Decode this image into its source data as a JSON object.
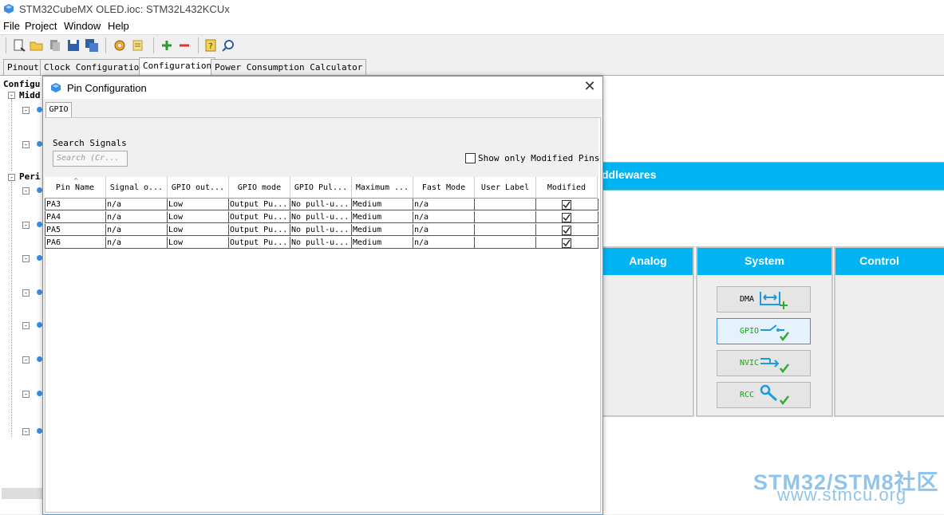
{
  "window": {
    "title": "STM32CubeMX OLED.ioc: STM32L432KCUx"
  },
  "menu": [
    "File",
    "Project",
    "Window",
    "Help"
  ],
  "tabs": [
    "Pinout",
    "Clock Configuration",
    "Configuration",
    "Power Consumption Calculator"
  ],
  "active_tab": "Configuration",
  "tree": {
    "root": "Configu",
    "middle": "Midd",
    "peri": "Peri"
  },
  "middlewares_band": "ddlewares",
  "categories": [
    {
      "title": "Analog",
      "buttons": []
    },
    {
      "title": "System",
      "buttons": [
        {
          "label": "DMA",
          "icon": "dma-icon"
        },
        {
          "label": "GPIO",
          "icon": "gpio-icon"
        },
        {
          "label": "NVIC",
          "icon": "nvic-icon"
        },
        {
          "label": "RCC",
          "icon": "wrench-icon"
        }
      ]
    },
    {
      "title": "Control",
      "buttons": []
    }
  ],
  "dialog": {
    "title": "Pin Configuration",
    "tab": "GPIO",
    "search_label": "Search Signals",
    "search_placeholder": "Search (Cr...",
    "show_modified_label": "Show only Modified Pins",
    "columns": [
      "Pin Name",
      "Signal o...",
      "GPIO out...",
      "GPIO mode",
      "GPIO Pul...",
      "Maximum ...",
      "Fast Mode",
      "User Label",
      "Modified"
    ],
    "rows": [
      {
        "pin": "PA3",
        "signal": "n/a",
        "out": "Low",
        "mode": "Output Pu...",
        "pull": "No pull-u...",
        "max": "Medium",
        "fast": "n/a",
        "user": "",
        "modified": true
      },
      {
        "pin": "PA4",
        "signal": "n/a",
        "out": "Low",
        "mode": "Output Pu...",
        "pull": "No pull-u...",
        "max": "Medium",
        "fast": "n/a",
        "user": "",
        "modified": true
      },
      {
        "pin": "PA5",
        "signal": "n/a",
        "out": "Low",
        "mode": "Output Pu...",
        "pull": "No pull-u...",
        "max": "Medium",
        "fast": "n/a",
        "user": "",
        "modified": true
      },
      {
        "pin": "PA6",
        "signal": "n/a",
        "out": "Low",
        "mode": "Output Pu...",
        "pull": "No pull-u...",
        "max": "Medium",
        "fast": "n/a",
        "user": "",
        "modified": true
      }
    ]
  },
  "watermark": {
    "line1": "STM32/STM8社区",
    "line2": "www.stmcu.org"
  },
  "colors": {
    "accent": "#03b4f3",
    "panel": "#eeeeee",
    "selected_border": "#3a8ee6"
  }
}
